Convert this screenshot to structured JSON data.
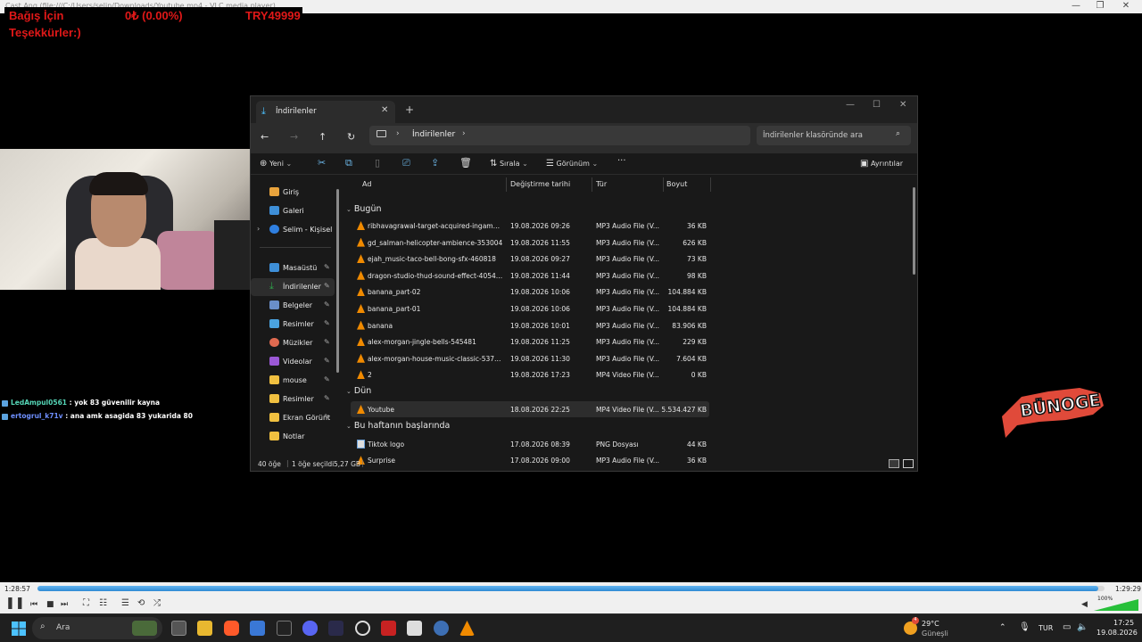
{
  "vlc": {
    "title": "Cast Ang (file:///C:/Users/selin/Downloads/Youtube.mp4 - VLC media player)",
    "time_elapsed": "1:28:57",
    "time_total": "1:29:29",
    "progress_percent": 99.4,
    "volume_label": "100%"
  },
  "donation": {
    "line1": "Bağış İçin",
    "percent": "0₺ (0.00%)",
    "goal": "TRY49999",
    "line2": "Teşekkürler:)"
  },
  "chat": [
    {
      "user": "LedAmpul0561",
      "message": " : yok 83 güvenilir kayna"
    },
    {
      "user": "ertogrul_k71v",
      "message": " : ana amk asagida 83 yukarida 80"
    }
  ],
  "logo_text": "BÜNOGE",
  "explorer": {
    "tab_title": "İndirilenler",
    "new_tab": "+",
    "address_path": "İndirilenler",
    "search_placeholder": "İndirilenler klasöründe ara",
    "toolbar": {
      "new_label": "Yeni",
      "sort_label": "Sırala",
      "view_label": "Görünüm",
      "more_label": "···",
      "details_label": "Ayrıntılar"
    },
    "sidebar": [
      {
        "label": "Giriş",
        "color": "#e8a33c",
        "pin": false
      },
      {
        "label": "Galeri",
        "color": "#3e8fd8",
        "pin": false
      },
      {
        "label": "Selim - Kişisel",
        "color": "#2f7fe0",
        "pin": false,
        "expandable": true
      },
      {
        "label": "Masaüstü",
        "color": "#3e8fd8",
        "pin": true
      },
      {
        "label": "İndirilenler",
        "color": "#2fa24a",
        "pin": true,
        "selected": true
      },
      {
        "label": "Belgeler",
        "color": "#6a8ec9",
        "pin": true
      },
      {
        "label": "Resimler",
        "color": "#4aa3e0",
        "pin": true
      },
      {
        "label": "Müzikler",
        "color": "#e06a50",
        "pin": true
      },
      {
        "label": "Videolar",
        "color": "#9b58d6",
        "pin": true
      },
      {
        "label": "mouse",
        "color": "#f0c040",
        "pin": true
      },
      {
        "label": "Resimler",
        "color": "#f0c040",
        "pin": true
      },
      {
        "label": "Ekran Görünt",
        "color": "#f0c040",
        "pin": true
      },
      {
        "label": "Notlar",
        "color": "#f0c040",
        "pin": false
      }
    ],
    "columns": {
      "name": "Ad",
      "date": "Değiştirme tarihi",
      "type": "Tür",
      "size": "Boyut"
    },
    "groups": {
      "today": "Bugün",
      "yesterday": "Dün",
      "this_week": "Bu haftanın başlarında"
    },
    "files_today": [
      {
        "name": "ribhavagrawal-target-acquired-ingame-s...",
        "date": "19.08.2026 09:26",
        "type": "MP3 Audio File (V...",
        "size": "36 KB"
      },
      {
        "name": "gd_salman-helicopter-ambience-353004",
        "date": "19.08.2026 11:55",
        "type": "MP3 Audio File (V...",
        "size": "626 KB"
      },
      {
        "name": "ejah_music-taco-bell-bong-sfx-460818",
        "date": "19.08.2026 09:27",
        "type": "MP3 Audio File (V...",
        "size": "73 KB"
      },
      {
        "name": "dragon-studio-thud-sound-effect-405470",
        "date": "19.08.2026 11:44",
        "type": "MP3 Audio File (V...",
        "size": "98 KB"
      },
      {
        "name": "banana_part-02",
        "date": "19.08.2026 10:06",
        "type": "MP3 Audio File (V...",
        "size": "104.884 KB"
      },
      {
        "name": "banana_part-01",
        "date": "19.08.2026 10:06",
        "type": "MP3 Audio File (V...",
        "size": "104.884 KB"
      },
      {
        "name": "banana",
        "date": "19.08.2026 10:01",
        "type": "MP3 Audio File (V...",
        "size": "83.906 KB"
      },
      {
        "name": "alex-morgan-jingle-bells-545481",
        "date": "19.08.2026 11:25",
        "type": "MP3 Audio File (V...",
        "size": "229 KB"
      },
      {
        "name": "alex-morgan-house-music-classic-537489",
        "date": "19.08.2026 11:30",
        "type": "MP3 Audio File (V...",
        "size": "7.604 KB"
      },
      {
        "name": "2",
        "date": "19.08.2026 17:23",
        "type": "MP4 Video File (V...",
        "size": "0 KB"
      }
    ],
    "files_yesterday": [
      {
        "name": "Youtube",
        "date": "18.08.2026 22:25",
        "type": "MP4 Video File (V...",
        "size": "5.534.427 KB"
      }
    ],
    "files_week": [
      {
        "name": "Tiktok logo",
        "date": "17.08.2026 08:39",
        "type": "PNG Dosyası",
        "size": "44 KB"
      },
      {
        "name": "Surprise",
        "date": "17.08.2026 09:00",
        "type": "MP3 Audio File (V...",
        "size": "36 KB"
      }
    ],
    "status": {
      "count": "40 öğe",
      "selected": "1 öğe seçildi",
      "selected_size": "5,27 GB"
    }
  },
  "taskbar": {
    "search_placeholder": "Ara",
    "weather_temp": "29°C",
    "weather_desc": "Güneşli",
    "language": "TUR",
    "time": "17:25",
    "date": "19.08.2026",
    "notification_count": "4"
  }
}
